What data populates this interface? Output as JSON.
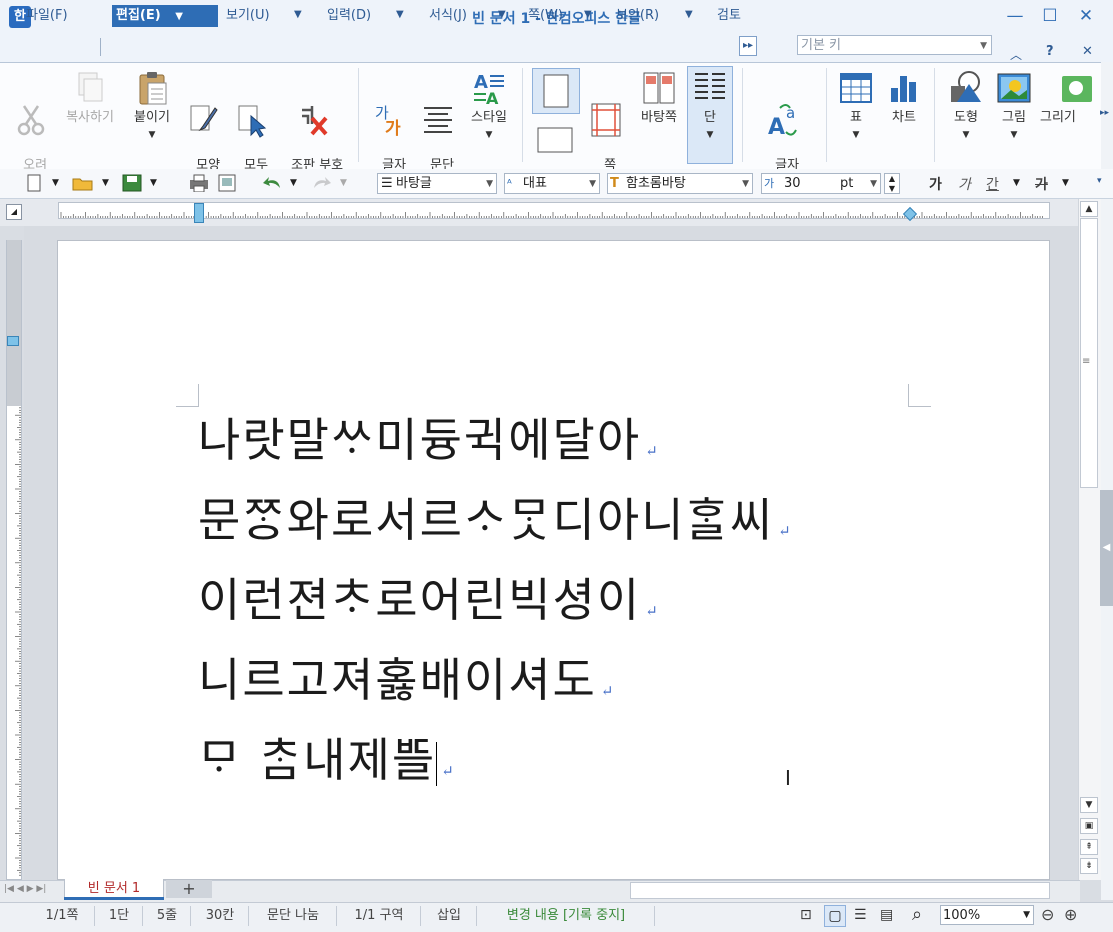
{
  "window": {
    "title": "빈 문서 1 - 한컴오피스 한글",
    "app_icon": "한"
  },
  "menus": [
    {
      "label": "파일(F)"
    },
    {
      "label": "편집(E)"
    },
    {
      "label": "보기(U)"
    },
    {
      "label": "입력(D)"
    },
    {
      "label": "서식(J)"
    },
    {
      "label": "쪽(W)"
    },
    {
      "label": "보안(R)"
    },
    {
      "label": "검토"
    }
  ],
  "style_combo": "기본 키",
  "ribbon": {
    "cut": "오려\n두기",
    "copy": "복사하기",
    "paste": "붙이기",
    "format_copy": "모양\n복사",
    "select_all": "모두\n선택",
    "clear_marks": "조판 부호\n지우기",
    "char_shape": "글자\n모양",
    "para_shape": "문단\n모양",
    "style": "스타일",
    "page_margin": "쪽\n여백",
    "master_page": "바탕쪽",
    "columns": "단",
    "change_char": "글자\n바꾸기",
    "table": "표",
    "chart": "차트",
    "shape": "도형",
    "picture": "그림",
    "drawing": "그리기"
  },
  "toolbar": {
    "style_value": "바탕글",
    "lang_value": "대표",
    "font_value": "함초롬바탕",
    "size_value": "30",
    "size_unit": "pt",
    "bold": "가",
    "italic": "가",
    "underline": "간",
    "strike": "가"
  },
  "document": {
    "lines": [
      "나랏말ᄊᆞ미듕귁에달아",
      "문ᄍᆞᆼ와로서르ᄉᆞᄆᆞᆺ디아니ᄒᆞᆯ씨",
      "이런젼ᄎᆞ로어린빅셩이",
      "니르고져홇배이셔도",
      "ᄆᆞ ᄎᆞᆷ내제ᄠᅳᆯ"
    ],
    "tab_name": "빈 문서 1"
  },
  "status": {
    "page": "1/1쪽",
    "column": "1단",
    "line": "5줄",
    "col_pos": "30칸",
    "para_split": "문단 나눔",
    "section": "1/1 구역",
    "insert": "삽입",
    "track": "변경 내용 [기록 중지]",
    "zoom": "100%"
  },
  "colors": {
    "accent": "#2e6db5",
    "track_text": "#3a8a3a",
    "para_mark": "#4a72c8"
  }
}
